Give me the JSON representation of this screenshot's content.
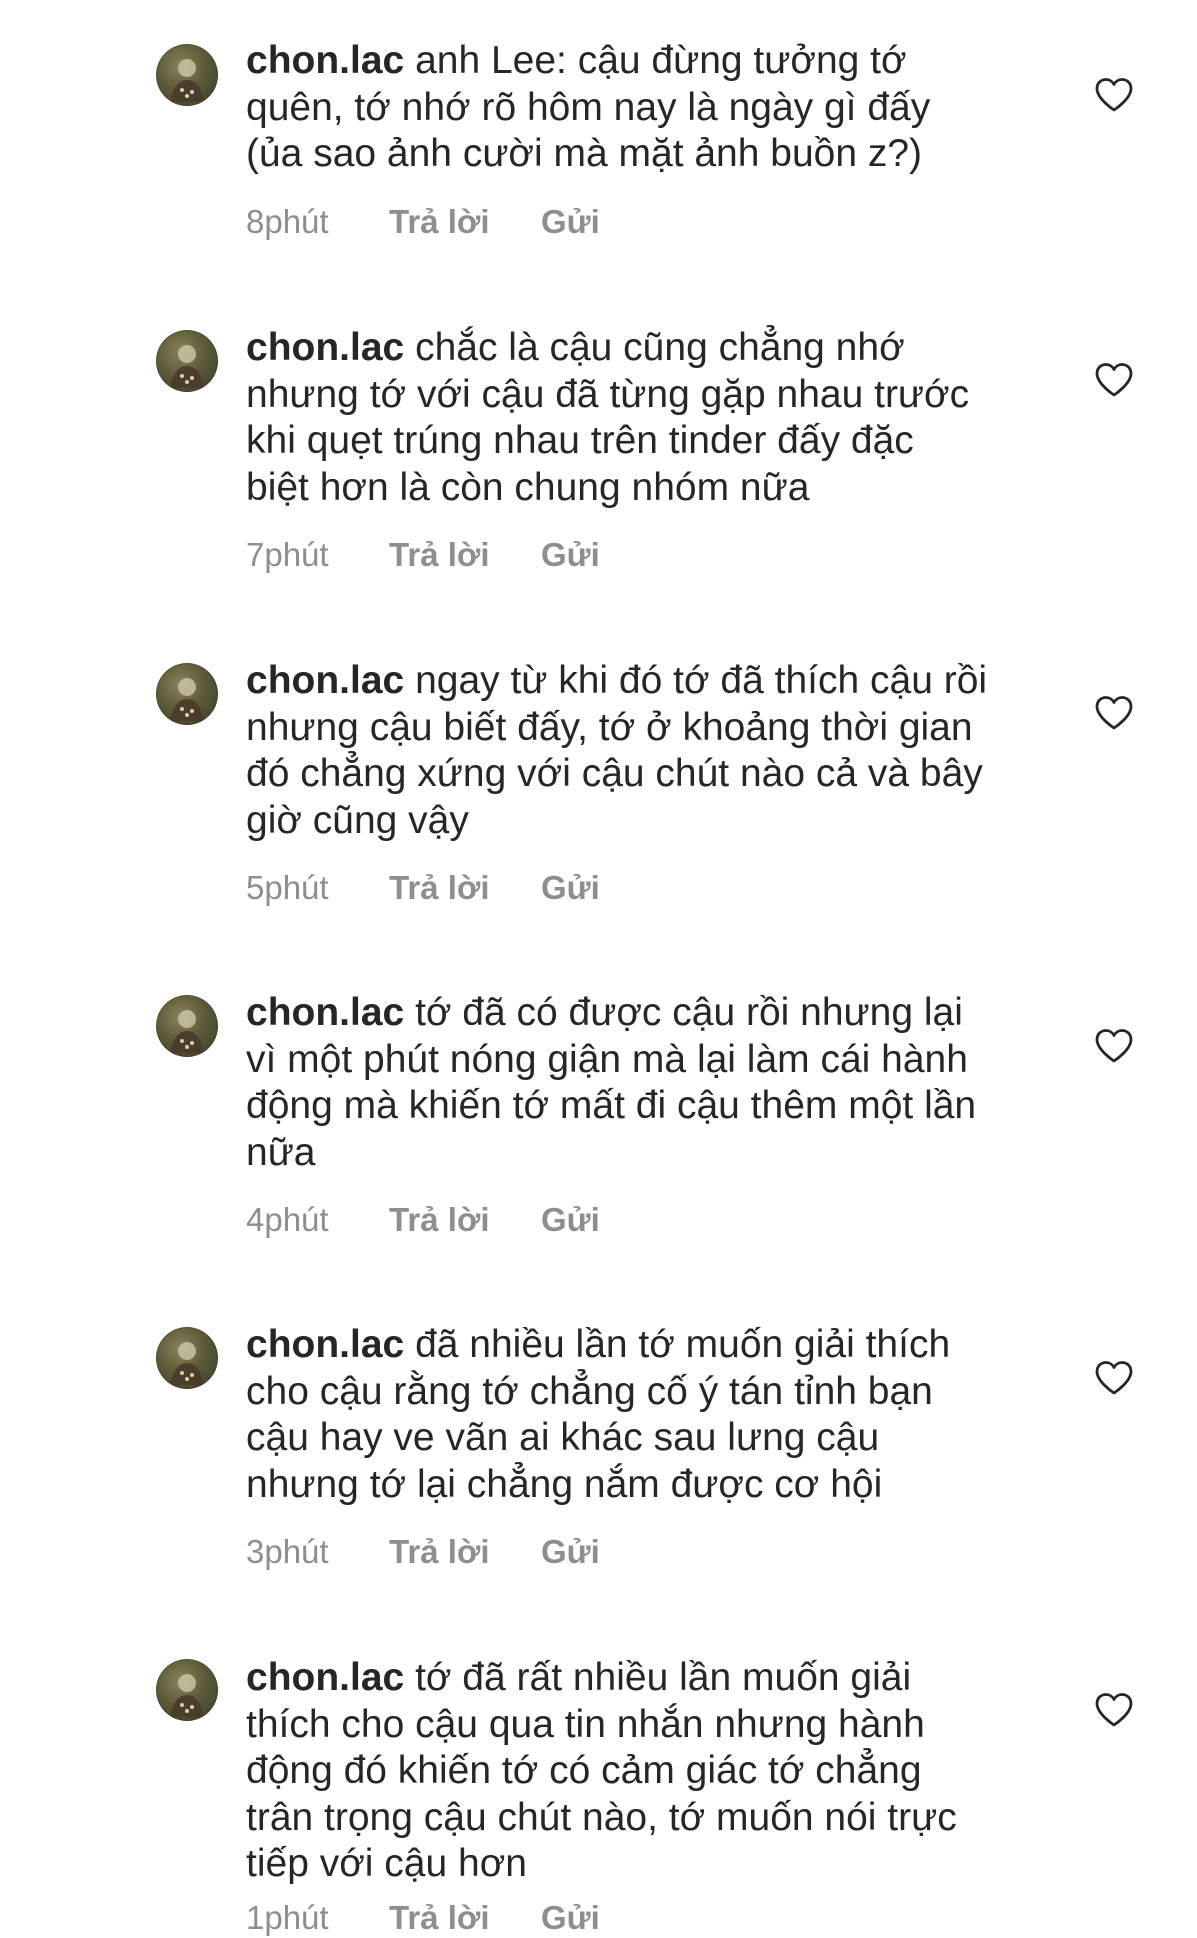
{
  "comments": [
    {
      "username": "chon.lac",
      "lines": [
        "anh Lee: cậu đừng tưởng tớ",
        "quên, tớ nhớ rõ hôm nay là ngày gì đấy",
        "(ủa sao ảnh cười mà mặt ảnh buồn z?)"
      ],
      "time": "8phút",
      "reply_label": "Trả lời",
      "send_label": "Gửi"
    },
    {
      "username": "chon.lac",
      "lines": [
        "chắc là cậu cũng chẳng nhớ",
        "nhưng tớ với cậu đã từng gặp nhau trước",
        "khi quẹt trúng nhau trên tinder đấy đặc",
        "biệt hơn là còn chung nhóm nữa"
      ],
      "time": "7phút",
      "reply_label": "Trả lời",
      "send_label": "Gửi"
    },
    {
      "username": "chon.lac",
      "lines": [
        "ngay từ khi đó tớ đã thích cậu rồi",
        "nhưng cậu biết đấy, tớ ở khoảng thời gian",
        "đó chẳng xứng với cậu chút nào cả và bây",
        "giờ cũng vậy"
      ],
      "time": "5phút",
      "reply_label": "Trả lời",
      "send_label": "Gửi"
    },
    {
      "username": "chon.lac",
      "lines": [
        "tớ đã có được cậu rồi nhưng lại",
        "vì một phút nóng giận mà lại làm cái hành",
        "động mà khiến tớ mất đi cậu thêm một lần",
        "nữa"
      ],
      "time": "4phút",
      "reply_label": "Trả lời",
      "send_label": "Gửi"
    },
    {
      "username": "chon.lac",
      "lines": [
        "đã nhiều lần tớ muốn giải thích",
        "cho cậu rằng tớ chẳng cố ý tán tỉnh bạn",
        "cậu hay ve vãn ai khác sau lưng cậu",
        "nhưng tớ lại chẳng nắm được cơ hội"
      ],
      "time": "3phút",
      "reply_label": "Trả lời",
      "send_label": "Gửi"
    },
    {
      "username": "chon.lac",
      "lines": [
        "tớ đã rất nhiều lần muốn giải",
        "thích cho cậu qua tin nhắn nhưng hành",
        "động đó khiến tớ có cảm giác tớ chẳng",
        "trân trọng cậu chút nào, tớ muốn nói trực",
        "tiếp với cậu hơn"
      ],
      "time": "1phút",
      "reply_label": "Trả lời",
      "send_label": "Gửi"
    }
  ],
  "icons": {
    "like": "heart-outline-icon",
    "avatar": "user-avatar"
  },
  "colors": {
    "text": "#262626",
    "meta": "#8e8e8e",
    "background": "#ffffff"
  }
}
